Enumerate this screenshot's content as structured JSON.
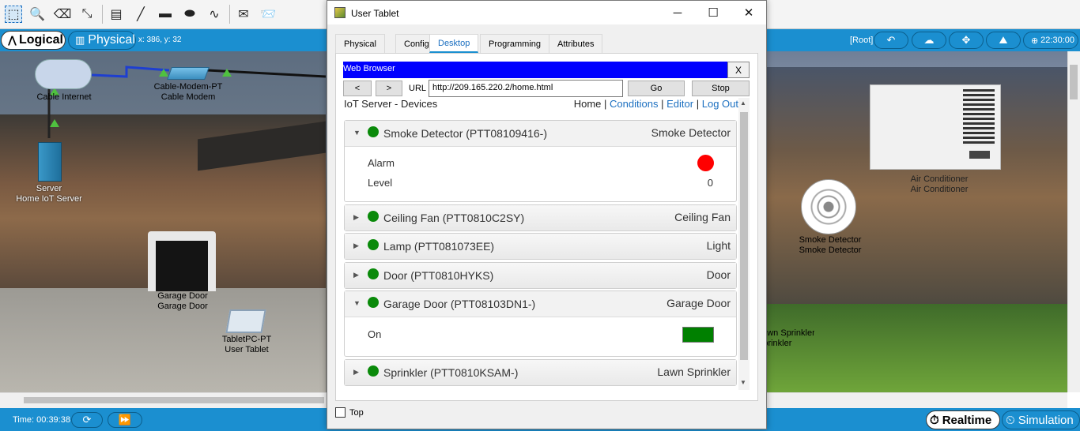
{
  "toolbar": {
    "icons": [
      "select-icon",
      "zoom-icon",
      "delete-icon",
      "resize-icon",
      "note-icon",
      "line-icon",
      "rectangle-icon",
      "ellipse-icon",
      "freeform-icon",
      "simple-pdu-icon",
      "complex-pdu-icon"
    ]
  },
  "modebar": {
    "logical": "Logical",
    "physical": "Physical",
    "coords": "x: 386, y: 32",
    "root": "[Root]",
    "clock": "22:30:00"
  },
  "workspace": {
    "labels": {
      "cable_internet": "Cable Internet",
      "modem": "Cable-Modem-PT\nCable Modem",
      "server": "Server\nHome IoT Server",
      "garage_door": "Garage Door\nGarage Door",
      "tablet": "TabletPC-PT\nUser Tablet",
      "aircon": "Air Conditioner\nAir Conditioner",
      "smoke": "Smoke Detector\nSmoke Detector",
      "sprinkler": "Lawn Sprinkler\nSprinkler"
    }
  },
  "status": {
    "time": "Time: 00:39:38",
    "realtime": "Realtime",
    "simulation": "Simulation"
  },
  "window": {
    "title": "User Tablet",
    "tabs": [
      "Physical",
      "Config",
      "Desktop",
      "Programming",
      "Attributes"
    ],
    "active_tab": "Desktop",
    "browser": {
      "title": "Web Browser",
      "close": "X",
      "back": "<",
      "forward": ">",
      "url_label": "URL",
      "url": "http://209.165.220.2/home.html",
      "go": "Go",
      "stop": "Stop"
    },
    "page": {
      "title": "IoT Server - Devices",
      "nav": {
        "home": "Home",
        "sep": "|",
        "conditions": "Conditions",
        "editor": "Editor",
        "logout": "Log Out"
      },
      "devices": [
        {
          "name": "Smoke Detector (PTT08109416-)",
          "type": "Smoke Detector",
          "expanded": true,
          "status_color": "#0a8a0a",
          "props": [
            {
              "label": "Alarm",
              "value_color": "#ff0000"
            },
            {
              "label": "Level",
              "value": "0"
            }
          ]
        },
        {
          "name": "Ceiling Fan (PTT0810C2SY)",
          "type": "Ceiling Fan",
          "expanded": false,
          "status_color": "#0a8a0a"
        },
        {
          "name": "Lamp (PTT081073EE)",
          "type": "Light",
          "expanded": false,
          "status_color": "#0a8a0a"
        },
        {
          "name": "Door (PTT0810HYKS)",
          "type": "Door",
          "expanded": false,
          "status_color": "#0a8a0a"
        },
        {
          "name": "Garage Door (PTT08103DN1-)",
          "type": "Garage Door",
          "expanded": true,
          "status_color": "#0a8a0a",
          "props": [
            {
              "label": "On",
              "value_color": "#008000"
            }
          ]
        },
        {
          "name": "Sprinkler (PTT0810KSAM-)",
          "type": "Lawn Sprinkler",
          "expanded": false,
          "status_color": "#0a8a0a"
        }
      ]
    },
    "top_checkbox": "Top"
  }
}
